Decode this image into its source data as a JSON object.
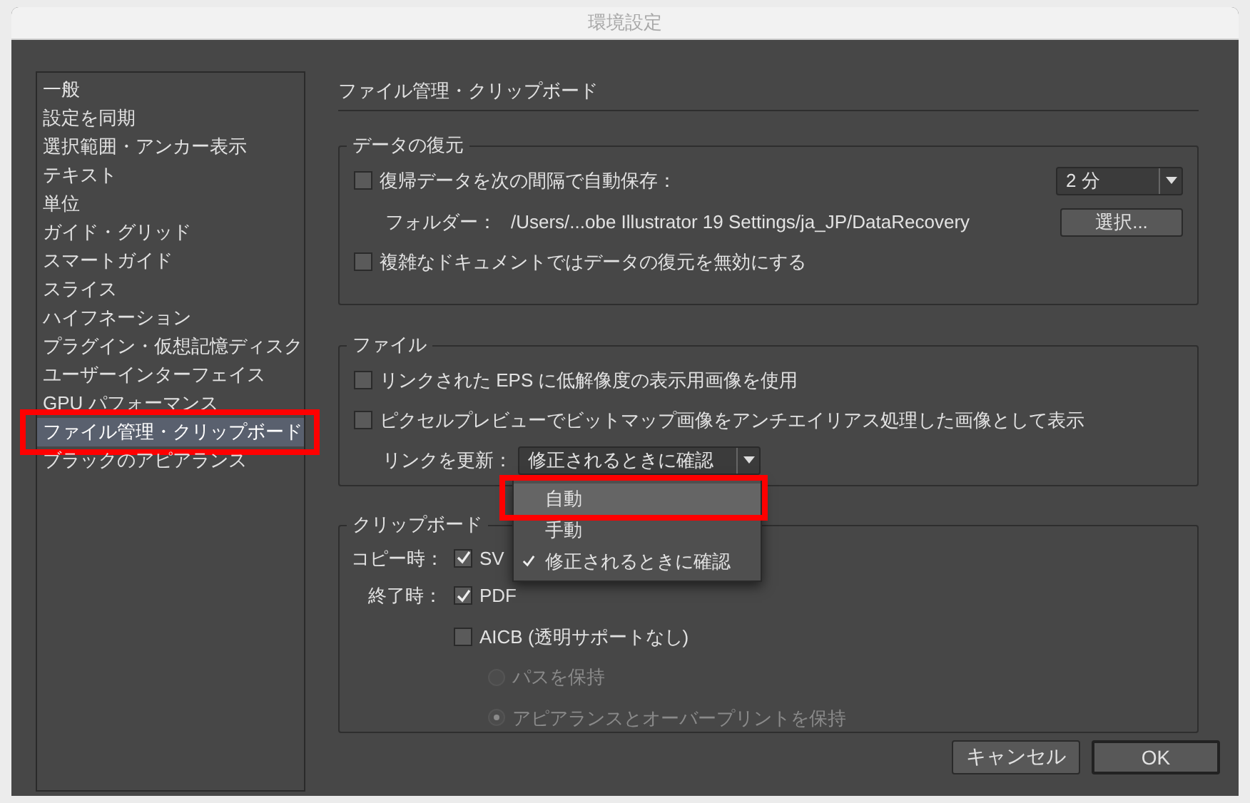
{
  "window": {
    "title": "環境設定"
  },
  "sidebar": {
    "items": [
      {
        "label": "一般",
        "selected": false,
        "annotated": false
      },
      {
        "label": "設定を同期",
        "selected": false,
        "annotated": false
      },
      {
        "label": "選択範囲・アンカー表示",
        "selected": false,
        "annotated": false
      },
      {
        "label": "テキスト",
        "selected": false,
        "annotated": false
      },
      {
        "label": "単位",
        "selected": false,
        "annotated": false
      },
      {
        "label": "ガイド・グリッド",
        "selected": false,
        "annotated": false
      },
      {
        "label": "スマートガイド",
        "selected": false,
        "annotated": false
      },
      {
        "label": "スライス",
        "selected": false,
        "annotated": false
      },
      {
        "label": "ハイフネーション",
        "selected": false,
        "annotated": false
      },
      {
        "label": "プラグイン・仮想記憶ディスク",
        "selected": false,
        "annotated": false
      },
      {
        "label": "ユーザーインターフェイス",
        "selected": false,
        "annotated": false
      },
      {
        "label": "GPU パフォーマンス",
        "selected": false,
        "annotated": false
      },
      {
        "label": "ファイル管理・クリップボード",
        "selected": true,
        "annotated": true
      },
      {
        "label": "ブラックのアピアランス",
        "selected": false,
        "annotated": false
      }
    ]
  },
  "heading": "ファイル管理・クリップボード",
  "data_recovery": {
    "title": "データの復元",
    "autosave": {
      "label": "復帰データを次の間隔で自動保存：",
      "checked": false
    },
    "interval": {
      "value": "2 分"
    },
    "folder_label": "フォルダー：",
    "folder_path": "/Users/...obe Illustrator 19 Settings/ja_JP/DataRecovery",
    "choose_button": "選択...",
    "disable_complex": {
      "label": "複雑なドキュメントではデータの復元を無効にする",
      "checked": false
    }
  },
  "files": {
    "title": "ファイル",
    "options": [
      {
        "label": "リンクされた EPS に低解像度の表示用画像を使用",
        "checked": false
      },
      {
        "label": "ピクセルプレビューでビットマップ画像をアンチエイリアス処理した画像として表示",
        "checked": false
      }
    ],
    "update_links_label": "リンクを更新：",
    "update_links_value": "修正されるときに確認",
    "menu": [
      {
        "label": "自動",
        "checked": false,
        "highlighted": true,
        "annotated": true
      },
      {
        "label": "手動",
        "checked": false,
        "highlighted": false,
        "annotated": false
      },
      {
        "label": "修正されるときに確認",
        "checked": true,
        "highlighted": false,
        "annotated": false
      }
    ]
  },
  "clipboard": {
    "title": "クリップボード",
    "copy_label": "コピー時：",
    "copy_option": {
      "label": "SV",
      "checked": true
    },
    "quit_label": "終了時：",
    "quit_options": [
      {
        "label": "PDF",
        "checked": true
      },
      {
        "label": "AICB (透明サポートなし)",
        "checked": false
      }
    ],
    "aicb_modes": [
      {
        "label": "パスを保持",
        "selected": false,
        "disabled": true
      },
      {
        "label": "アピアランスとオーバープリントを保持",
        "selected": true,
        "disabled": true
      }
    ]
  },
  "buttons": [
    {
      "label": "キャンセル",
      "default": false
    },
    {
      "label": "OK",
      "default": true
    }
  ]
}
